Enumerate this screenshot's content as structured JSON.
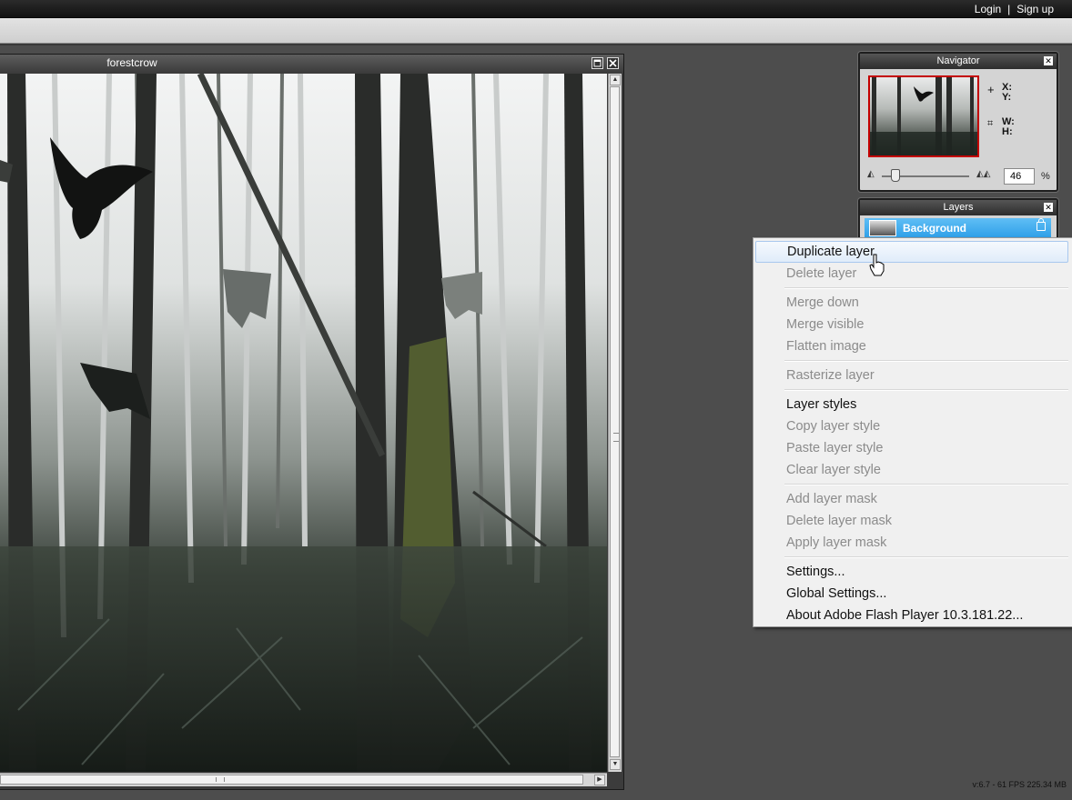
{
  "header": {
    "login_label": "Login",
    "separator": "|",
    "signup_label": "Sign up"
  },
  "document": {
    "title": "forestcrow",
    "maximize_icon": "maximize-icon",
    "close_icon": "close-icon"
  },
  "navigator": {
    "title": "Navigator",
    "x_label": "X:",
    "y_label": "Y:",
    "w_label": "W:",
    "h_label": "H:",
    "zoom_value": "46",
    "zoom_unit": "%"
  },
  "layers": {
    "title": "Layers",
    "items": [
      {
        "name": "Background",
        "locked": true,
        "selected": true
      }
    ]
  },
  "context_menu": {
    "groups": [
      [
        {
          "label": "Duplicate layer",
          "enabled": true,
          "highlighted": true
        },
        {
          "label": "Delete layer",
          "enabled": false
        }
      ],
      [
        {
          "label": "Merge down",
          "enabled": false
        },
        {
          "label": "Merge visible",
          "enabled": false
        },
        {
          "label": "Flatten image",
          "enabled": false
        }
      ],
      [
        {
          "label": "Rasterize layer",
          "enabled": false
        }
      ],
      [
        {
          "label": "Layer styles",
          "enabled": true
        },
        {
          "label": "Copy layer style",
          "enabled": false
        },
        {
          "label": "Paste layer style",
          "enabled": false
        },
        {
          "label": "Clear layer style",
          "enabled": false
        }
      ],
      [
        {
          "label": "Add layer mask",
          "enabled": false
        },
        {
          "label": "Delete layer mask",
          "enabled": false
        },
        {
          "label": "Apply layer mask",
          "enabled": false
        }
      ],
      [
        {
          "label": "Settings...",
          "enabled": true
        },
        {
          "label": "Global Settings...",
          "enabled": true
        },
        {
          "label": "About Adobe Flash Player 10.3.181.22...",
          "enabled": true
        }
      ]
    ]
  },
  "status_bar": {
    "text": "v:6.7 - 61 FPS 225.34 MB"
  },
  "colors": {
    "workspace": "#4d4d4d",
    "layer_selected": "#3aa6ee",
    "navigator_frame": "#c40000"
  }
}
